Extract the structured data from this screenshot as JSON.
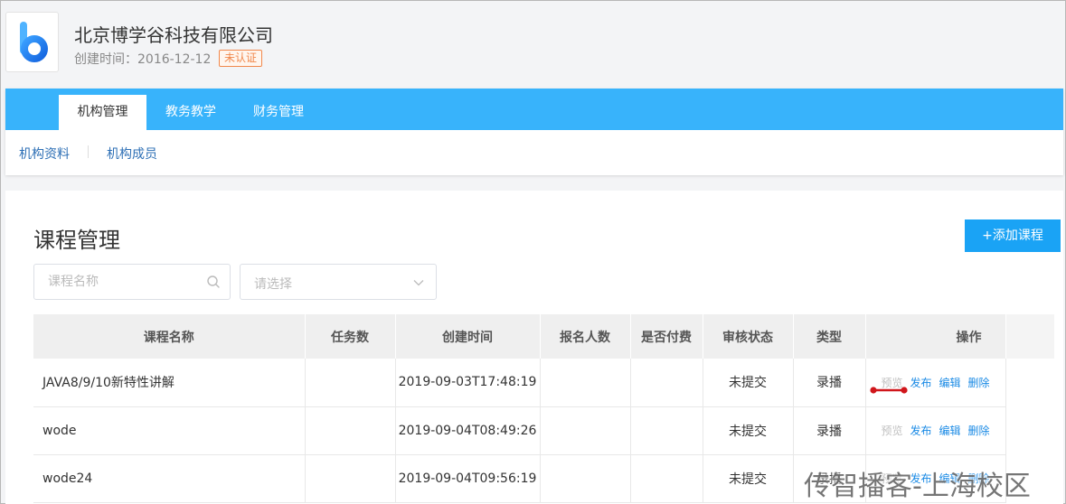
{
  "org": {
    "name": "北京博学谷科技有限公司",
    "created_label": "创建时间：2016-12-12",
    "badge": "未认证"
  },
  "tabs": [
    {
      "label": "机构管理",
      "active": true
    },
    {
      "label": "教务教学",
      "active": false
    },
    {
      "label": "财务管理",
      "active": false
    }
  ],
  "subnav": [
    {
      "label": "机构资料"
    },
    {
      "label": "机构成员"
    }
  ],
  "page": {
    "title": "课程管理",
    "add_button": "+添加课程",
    "search_placeholder": "课程名称",
    "select_placeholder": "请选择"
  },
  "table": {
    "headers": [
      "课程名称",
      "任务数",
      "创建时间",
      "报名人数",
      "是否付费",
      "审核状态",
      "类型",
      "操作"
    ],
    "rows": [
      {
        "name": "JAVA8/9/10新特性讲解",
        "tasks": "",
        "created": "2019-09-03T17:48:19",
        "enrolled": "",
        "paid": "",
        "status": "未提交",
        "type": "录播"
      },
      {
        "name": "wode",
        "tasks": "",
        "created": "2019-09-04T08:49:26",
        "enrolled": "",
        "paid": "",
        "status": "未提交",
        "type": "录播"
      },
      {
        "name": "wode24",
        "tasks": "",
        "created": "2019-09-04T09:56:19",
        "enrolled": "",
        "paid": "",
        "status": "未提交",
        "type": "录播"
      }
    ],
    "actions": {
      "preview": "预览",
      "publish": "发布",
      "edit": "编辑",
      "delete": "删除"
    }
  },
  "watermark": "传智播客-上海校区",
  "colors": {
    "accent": "#38b3fb",
    "button": "#1aa3f5",
    "link": "#1a8ae5",
    "badge": "#f1884c"
  }
}
